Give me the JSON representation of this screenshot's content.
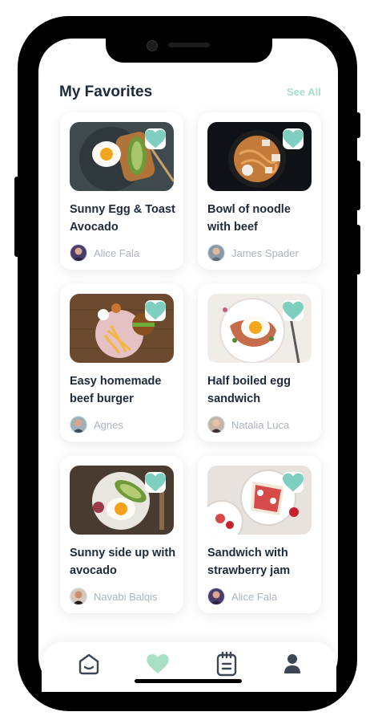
{
  "header": {
    "title": "My Favorites",
    "see_all_label": "See All"
  },
  "colors": {
    "accent": "#7ecfc0",
    "accent_light": "#a8e0c6",
    "text_dark": "#1d2a3a",
    "text_muted": "#aab4c0"
  },
  "recipes": [
    {
      "title": "Sunny Egg & Toast Avocado",
      "author": "Alice Fala",
      "favorited": true,
      "fav_icon": "heart-icon"
    },
    {
      "title": "Bowl of noodle with beef",
      "author": "James Spader",
      "favorited": true,
      "fav_icon": "heart-icon"
    },
    {
      "title": "Easy homemade beef burger",
      "author": "Agnes",
      "favorited": true,
      "fav_icon": "heart-icon"
    },
    {
      "title": "Half boiled egg sandwich",
      "author": "Natalia Luca",
      "favorited": true,
      "fav_icon": "heart-icon"
    },
    {
      "title": "Sunny side up with avocado",
      "author": "Navabi Balqis",
      "favorited": true,
      "fav_icon": "heart-icon"
    },
    {
      "title": "Sandwich with strawberry jam",
      "author": "Alice Fala",
      "favorited": true,
      "fav_icon": "heart-icon"
    }
  ],
  "tabbar": {
    "items": [
      {
        "icon": "home-icon",
        "active": false
      },
      {
        "icon": "heart-icon",
        "active": true
      },
      {
        "icon": "notepad-icon",
        "active": false
      },
      {
        "icon": "profile-icon",
        "active": false
      }
    ]
  }
}
